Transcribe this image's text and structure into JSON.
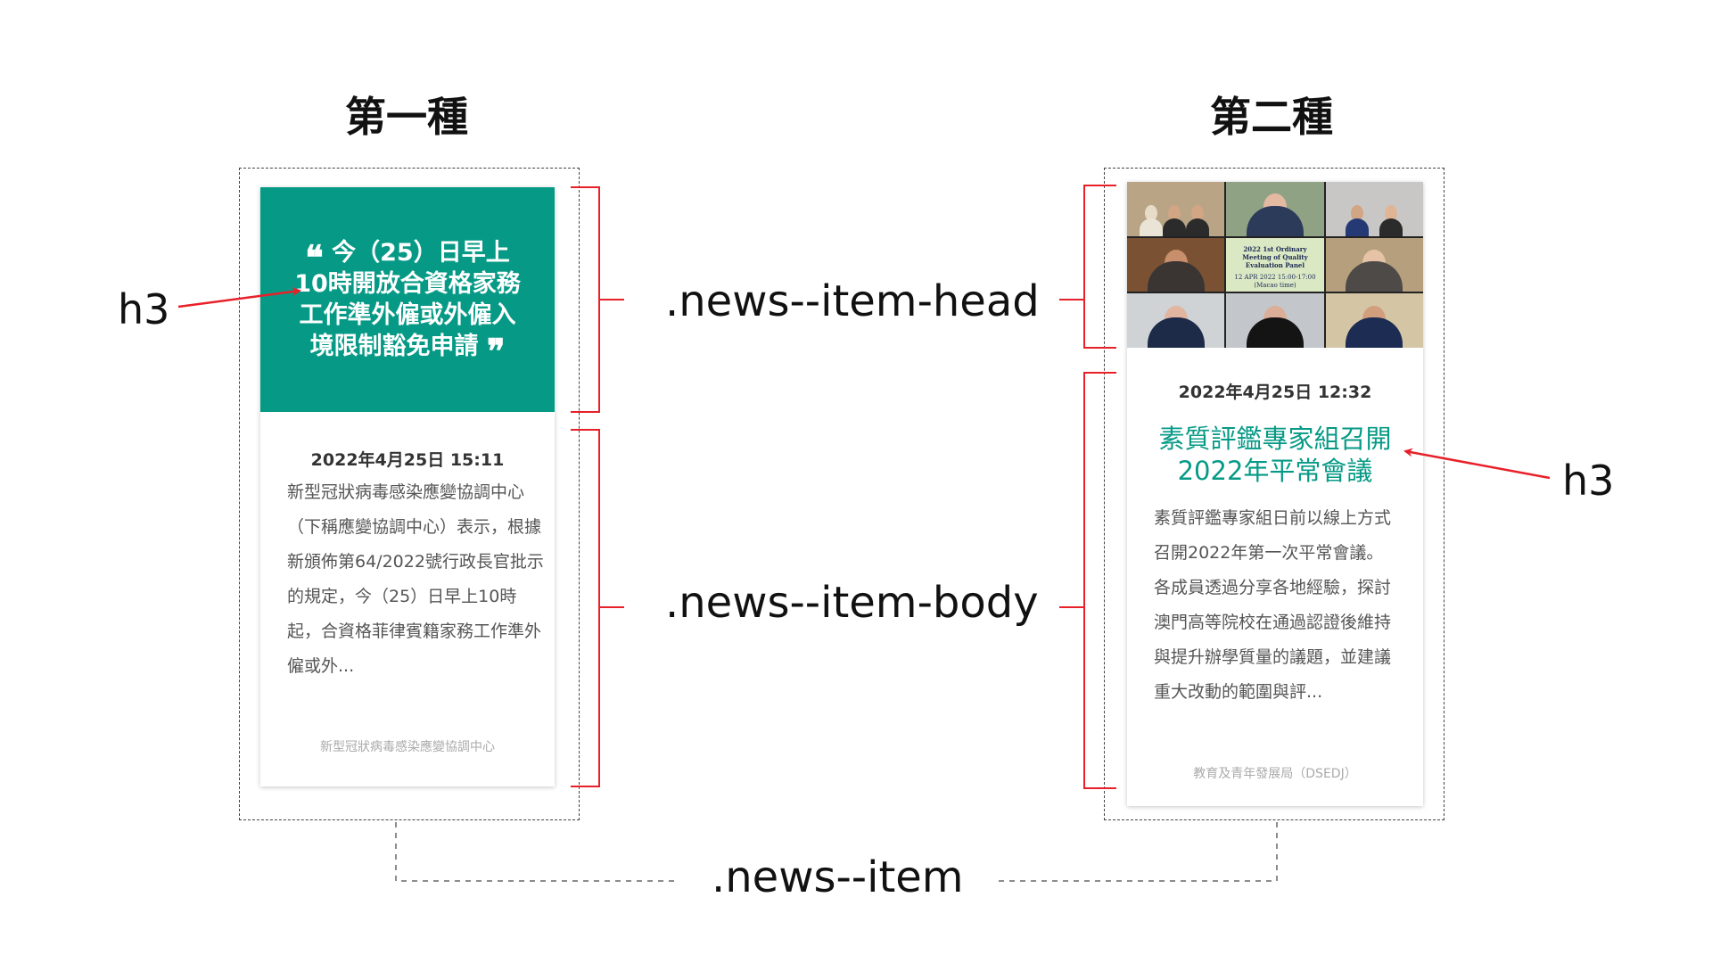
{
  "headings": {
    "left": "第一種",
    "right": "第二種"
  },
  "labels": {
    "h3_left": "h3",
    "h3_right": "h3",
    "item_head": ".news--item-head",
    "item_body": ".news--item-body",
    "item": ".news--item"
  },
  "card_type1": {
    "quote_title": "今（25）日早上10時開放合資格家務工作準外僱或外僱入境限制豁免申請",
    "date": "2022年4月25日 15:11",
    "excerpt": "新型冠狀病毒感染應變協調中心（下稱應變協調中心）表示，根據新頒佈第64/2022號行政長官批示的規定，今（25）日早上10時起，合資格菲律賓籍家務工作準外僱或外...",
    "source": "新型冠狀病毒感染應變協調中心"
  },
  "card_type2": {
    "photo_slide_title": "2022 1st Ordinary Meeting of Quality Evaluation Panel",
    "photo_slide_date": "12 APR 2022 15:00-17:00 (Macao time)",
    "date": "2022年4月25日 12:32",
    "title": "素質評鑑專家組召開2022年平常會議",
    "excerpt": "素質評鑑專家組日前以線上方式召開2022年第一次平常會議。各成員透過分享各地經驗，探討澳門高等院校在通過認證後維持與提升辦學質量的議題，並建議重大改動的範圍與評...",
    "source": "教育及青年發展局（DSEDJ）"
  },
  "colors": {
    "accent_green": "#069a86",
    "annotation_red": "#e8202a",
    "dashed_border": "#444444"
  }
}
